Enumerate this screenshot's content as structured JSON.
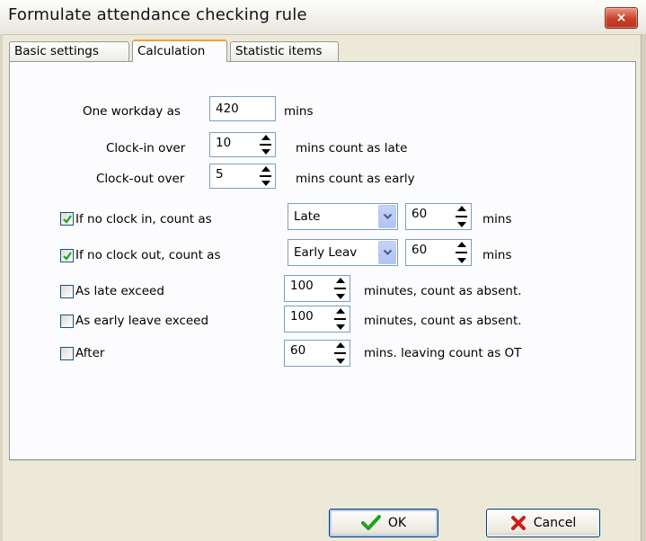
{
  "window": {
    "title": "Formulate attendance checking rule",
    "close_icon": "×"
  },
  "tabs": [
    {
      "label": "Basic settings",
      "active": false
    },
    {
      "label": "Calculation",
      "active": true
    },
    {
      "label": "Statistic items",
      "active": false
    }
  ],
  "calculation": {
    "workday": {
      "label": "One workday as",
      "value": "420",
      "unit": "mins"
    },
    "clock_in": {
      "label": "Clock-in over",
      "value": "10",
      "suffix": "mins count as late"
    },
    "clock_out": {
      "label": "Clock-out over",
      "value": "5",
      "suffix": "mins count as early"
    },
    "no_clock_in": {
      "checked": true,
      "label": "If no clock in, count as",
      "type": "Late",
      "value": "60",
      "unit": "mins"
    },
    "no_clock_out": {
      "checked": true,
      "label": "If no clock out, count as",
      "type": "Early Leav",
      "value": "60",
      "unit": "mins"
    },
    "late_exceed": {
      "checked": false,
      "label": "As late exceed",
      "value": "100",
      "suffix": "minutes, count as absent."
    },
    "early_exceed": {
      "checked": false,
      "label": "As early leave exceed",
      "value": "100",
      "suffix": "minutes, count as absent."
    },
    "after": {
      "checked": false,
      "label": "After",
      "value": "60",
      "suffix": "mins. leaving count as OT"
    }
  },
  "buttons": {
    "ok_label": "OK",
    "cancel_label": "Cancel"
  },
  "colors": {
    "check_green": "#21a121",
    "cancel_red": "#cc1b1b",
    "tab_accent": "#f0a333",
    "close_red": "#c8402a"
  }
}
